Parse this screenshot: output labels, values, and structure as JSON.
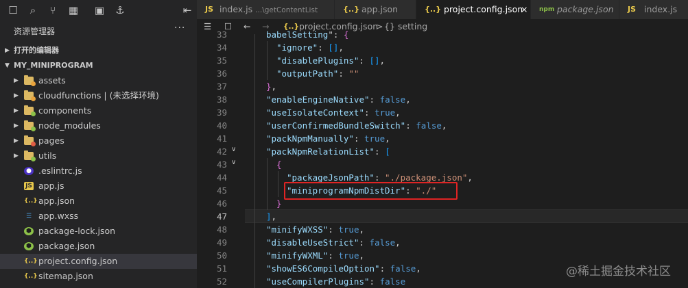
{
  "activity_icons": [
    "files-icon",
    "search-icon",
    "source-control-icon",
    "extensions-icon",
    "image-icon",
    "docker-icon"
  ],
  "sidebar": {
    "title": "资源管理器",
    "more": "···",
    "collapse_icon": "collapse-panel-icon",
    "open_editors": "打开的编辑器",
    "project": "MY_MINIPROGRAM",
    "items": [
      {
        "label": "assets",
        "kind": "folder",
        "badge": "#e8a33d"
      },
      {
        "label": "cloudfunctions | (未选择环境)",
        "kind": "folder",
        "badge": "#e8a33d"
      },
      {
        "label": "components",
        "kind": "folder",
        "badge": "#8dc149"
      },
      {
        "label": "node_modules",
        "kind": "folder",
        "badge": "#8dc149"
      },
      {
        "label": "pages",
        "kind": "folder",
        "badge": "#e05d44"
      },
      {
        "label": "utils",
        "kind": "folder",
        "badge": "#8dc149"
      },
      {
        "label": ".eslintrc.js",
        "kind": "eslint"
      },
      {
        "label": "app.js",
        "kind": "js"
      },
      {
        "label": "app.json",
        "kind": "json"
      },
      {
        "label": "app.wxss",
        "kind": "css"
      },
      {
        "label": "package-lock.json",
        "kind": "npm"
      },
      {
        "label": "package.json",
        "kind": "npm"
      },
      {
        "label": "project.config.json",
        "kind": "json"
      },
      {
        "label": "sitemap.json",
        "kind": "json"
      }
    ],
    "selected_index": 12
  },
  "tabs": [
    {
      "icon": "JS",
      "label": "index.js",
      "sub": "...\\getContentList",
      "active": false
    },
    {
      "icon": "{..}",
      "label": "app.json",
      "sub": "",
      "active": false
    },
    {
      "icon": "{..}",
      "label": "project.config.json",
      "sub": "",
      "active": true,
      "close": "×"
    },
    {
      "icon": "npm",
      "label": "package.json",
      "sub": "",
      "active": false
    },
    {
      "icon": "JS",
      "label": "index.js",
      "sub": "",
      "active": false
    }
  ],
  "breadcrumb": {
    "file": "project.config.json",
    "sep": ">",
    "symbol": "{} setting"
  },
  "code_lines": [
    {
      "n": "33",
      "t": "babelSetting\": {"
    },
    {
      "n": "34",
      "t": "\"ignore\": [],"
    },
    {
      "n": "35",
      "t": "\"disablePlugins\": [],"
    },
    {
      "n": "36",
      "t": "\"outputPath\": \"\""
    },
    {
      "n": "37",
      "t": "},"
    },
    {
      "n": "38",
      "t": "\"enableEngineNative\": false,"
    },
    {
      "n": "39",
      "t": "\"useIsolateContext\": true,"
    },
    {
      "n": "40",
      "t": "\"userConfirmedBundleSwitch\": false,"
    },
    {
      "n": "41",
      "t": "\"packNpmManually\": true,"
    },
    {
      "n": "42",
      "t": "\"packNpmRelationList\": ["
    },
    {
      "n": "43",
      "t": "{"
    },
    {
      "n": "44",
      "t": "\"packageJsonPath\": \"./package.json\","
    },
    {
      "n": "45",
      "t": "\"miniprogramNpmDistDir\": \"./\""
    },
    {
      "n": "46",
      "t": "}"
    },
    {
      "n": "47",
      "t": "],"
    },
    {
      "n": "48",
      "t": "\"minifyWXSS\": true,"
    },
    {
      "n": "49",
      "t": "\"disableUseStrict\": false,"
    },
    {
      "n": "50",
      "t": "\"minifyWXML\": true,"
    },
    {
      "n": "51",
      "t": "\"showES6CompileOption\": false,"
    },
    {
      "n": "52",
      "t": "\"useCompilerPlugins\": false"
    }
  ],
  "current_line": "47",
  "watermark": "@稀土掘金技术社区"
}
